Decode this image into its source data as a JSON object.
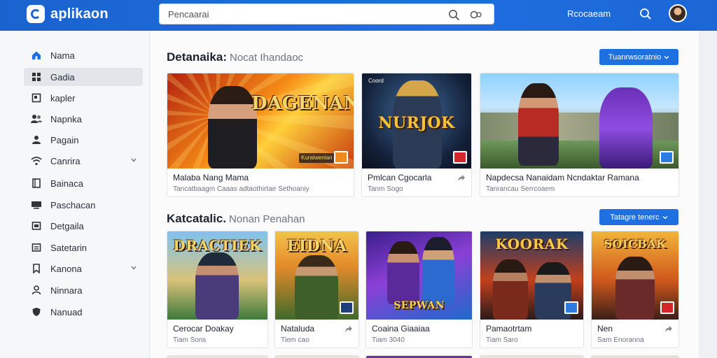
{
  "app": {
    "title": "aplikaon"
  },
  "search": {
    "placeholder": "Pencaarai"
  },
  "topbar": {
    "right_label": "Rcocaeam"
  },
  "sidebar": {
    "items": [
      {
        "label": "Nama",
        "icon": "home-icon"
      },
      {
        "label": "Gadia",
        "icon": "grid-icon"
      },
      {
        "label": "kapler",
        "icon": "square-icon"
      },
      {
        "label": "Napnka",
        "icon": "users-icon"
      },
      {
        "label": "Pagain",
        "icon": "user-icon"
      },
      {
        "label": "Canrira",
        "icon": "wifi-icon"
      },
      {
        "label": "Bainaca",
        "icon": "book-icon"
      },
      {
        "label": "Paschacan",
        "icon": "monitor-icon"
      },
      {
        "label": "Detgaila",
        "icon": "folder-icon"
      },
      {
        "label": "Satetarin",
        "icon": "list-icon"
      },
      {
        "label": "Kanona",
        "icon": "bookmark-icon"
      },
      {
        "label": "Ninnara",
        "icon": "person-icon"
      },
      {
        "label": "Nanuad",
        "icon": "shield-icon"
      }
    ]
  },
  "section1": {
    "title": "Detanaika:",
    "subtitle": "Nocat Ihandaoc",
    "button": "Tuanrwsoratnio",
    "cards": [
      {
        "image_text": "DAGENAN",
        "image_tag": "Kuratwenian",
        "title": "Malaba Nang Mama",
        "subtitle": "Tancatbaagm Caaas adtaothirtae Sethoaniy"
      },
      {
        "image_text": "NURJOK",
        "image_tag": "Coord",
        "title": "Pmlcan Cgocarla",
        "subtitle": "Tanm Sogo"
      },
      {
        "image_text": "",
        "image_tag": "",
        "title": "Napdecsa Nanaidam Ncndaktar Ramana",
        "subtitle": "Tanrancau Serrcoaem"
      }
    ]
  },
  "section2": {
    "title": "Katcatalic.",
    "subtitle": "Nonan Penahan",
    "button": "Tatagre tenerc",
    "cards": [
      {
        "image_text": "DRACTIEK",
        "title": "Cerocar Doakay",
        "subtitle": "Tiam Sons"
      },
      {
        "image_text": "EIDNA",
        "title": "Nataluda",
        "subtitle": "Tiem cao"
      },
      {
        "image_text": "SEPWAN",
        "title": "Coaina Giaaiaa",
        "subtitle": "Tiam 3040"
      },
      {
        "image_text": "KOORAK",
        "title": "Pamaotrtam",
        "subtitle": "Tiam Saro"
      },
      {
        "image_text": "SOICBAK",
        "title": "Nen",
        "subtitle": "Sam Enoranna"
      }
    ]
  },
  "colors": {
    "accent": "#1e6fe0",
    "topbar": "#1c66d6"
  }
}
